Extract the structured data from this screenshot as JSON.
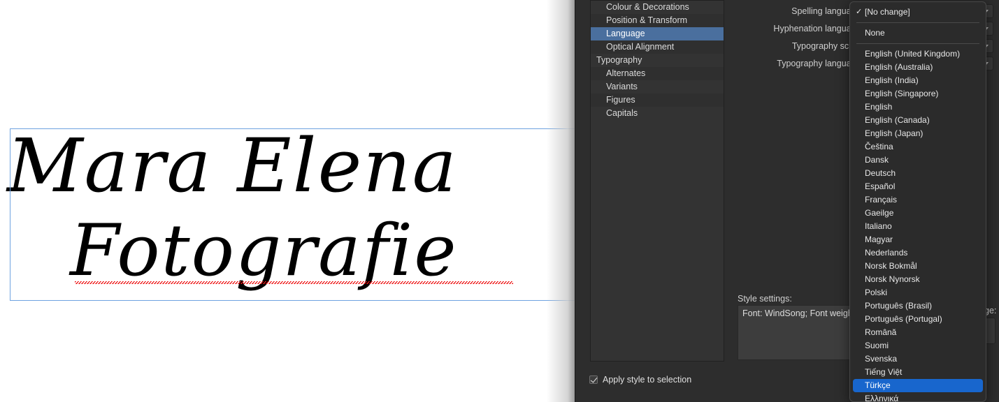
{
  "canvas": {
    "text_line_1": "Mara Elena",
    "text_line_2": "Fotografie",
    "spellcheck_marker": "spellcheck-squiggle"
  },
  "panel": {
    "categories": [
      {
        "label": "Colour & Decorations",
        "level": "child",
        "selected": false
      },
      {
        "label": "Position & Transform",
        "level": "child",
        "selected": false
      },
      {
        "label": "Language",
        "level": "child",
        "selected": true
      },
      {
        "label": "Optical Alignment",
        "level": "child",
        "selected": false
      },
      {
        "label": "Typography",
        "level": "group",
        "selected": false
      },
      {
        "label": "Alternates",
        "level": "child",
        "selected": false
      },
      {
        "label": "Variants",
        "level": "child",
        "selected": false
      },
      {
        "label": "Figures",
        "level": "child",
        "selected": false
      },
      {
        "label": "Capitals",
        "level": "child",
        "selected": false
      }
    ],
    "fields": [
      {
        "label": "Spelling language:",
        "value": ""
      },
      {
        "label": "Hyphenation language:",
        "value": ""
      },
      {
        "label": "Typography script:",
        "value": ""
      },
      {
        "label": "Typography language:",
        "value": ""
      }
    ],
    "style_settings_label": "Style settings:",
    "style_settings_value": "Font: WindSong; Font weight: M",
    "apply_checkbox_label": "Apply style to selection",
    "apply_checkbox_checked": true,
    "trailing_label": "ge:"
  },
  "dropdown": {
    "name": "language-dropdown",
    "selected_check": "[No change]",
    "highlighted": "Türkçe",
    "items": [
      {
        "label": "[No change]",
        "checked": true,
        "highlight": false
      },
      {
        "sep": true
      },
      {
        "label": "None",
        "checked": false,
        "highlight": false
      },
      {
        "sep": true
      },
      {
        "label": "English (United Kingdom)",
        "checked": false,
        "highlight": false
      },
      {
        "label": "English (Australia)",
        "checked": false,
        "highlight": false
      },
      {
        "label": "English (India)",
        "checked": false,
        "highlight": false
      },
      {
        "label": "English (Singapore)",
        "checked": false,
        "highlight": false
      },
      {
        "label": "English",
        "checked": false,
        "highlight": false
      },
      {
        "label": "English (Canada)",
        "checked": false,
        "highlight": false
      },
      {
        "label": "English (Japan)",
        "checked": false,
        "highlight": false
      },
      {
        "label": "Čeština",
        "checked": false,
        "highlight": false
      },
      {
        "label": "Dansk",
        "checked": false,
        "highlight": false
      },
      {
        "label": "Deutsch",
        "checked": false,
        "highlight": false
      },
      {
        "label": "Español",
        "checked": false,
        "highlight": false
      },
      {
        "label": "Français",
        "checked": false,
        "highlight": false
      },
      {
        "label": "Gaeilge",
        "checked": false,
        "highlight": false
      },
      {
        "label": "Italiano",
        "checked": false,
        "highlight": false
      },
      {
        "label": "Magyar",
        "checked": false,
        "highlight": false
      },
      {
        "label": "Nederlands",
        "checked": false,
        "highlight": false
      },
      {
        "label": "Norsk Bokmål",
        "checked": false,
        "highlight": false
      },
      {
        "label": "Norsk Nynorsk",
        "checked": false,
        "highlight": false
      },
      {
        "label": "Polski",
        "checked": false,
        "highlight": false
      },
      {
        "label": "Português (Brasil)",
        "checked": false,
        "highlight": false
      },
      {
        "label": "Português (Portugal)",
        "checked": false,
        "highlight": false
      },
      {
        "label": "Română",
        "checked": false,
        "highlight": false
      },
      {
        "label": "Suomi",
        "checked": false,
        "highlight": false
      },
      {
        "label": "Svenska",
        "checked": false,
        "highlight": false
      },
      {
        "label": "Tiếng Việt",
        "checked": false,
        "highlight": false
      },
      {
        "label": "Türkçe",
        "checked": false,
        "highlight": true
      },
      {
        "label": "Ελληνικά",
        "checked": false,
        "highlight": false
      }
    ]
  },
  "colors": {
    "panel_bg": "#2d2d2d",
    "list_bg": "#333333",
    "selection_blue": "#4a6f9e",
    "dropdown_highlight": "#1866cd",
    "frame_blue": "#6ea2e0",
    "spell_red": "#ee1111"
  }
}
